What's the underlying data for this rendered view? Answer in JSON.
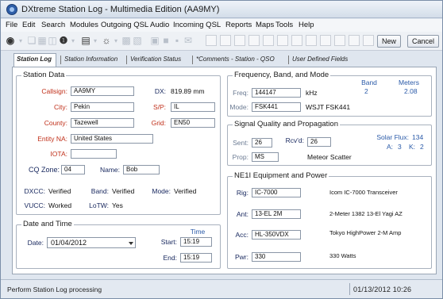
{
  "window": {
    "title": "DXtreme Station Log - Multimedia Edition (AA9MY)"
  },
  "menu": [
    "File",
    "Edit",
    "Search",
    "Modules",
    "Outgoing QSL",
    "Audio",
    "Incoming QSL",
    "Reports",
    "Maps",
    "Tools",
    "Help"
  ],
  "toolbar": {
    "new_label": "New",
    "cancel_label": "Cancel"
  },
  "tabs": [
    "Station Log",
    "Station Information",
    "Verification Status",
    "*Comments - Station - QSO",
    "User Defined Fields"
  ],
  "station_data": {
    "title": "Station Data",
    "callsign_label": "Callsign:",
    "callsign": "AA9MY",
    "dx_label": "DX:",
    "dx": "819.89 mm",
    "city_label": "City:",
    "city": "Pekin",
    "sp_label": "S/P:",
    "sp": "IL",
    "county_label": "County:",
    "county": "Tazewell",
    "grid_label": "Grid:",
    "grid": "EN50",
    "entity_label": "Entity NA:",
    "entity": "United States",
    "iota_label": "IOTA:",
    "iota": "",
    "cq_label": "CQ Zone:",
    "cq": "04",
    "name_label": "Name:",
    "name": "Bob",
    "dxcc_label": "DXCC:",
    "dxcc": "Verified",
    "band_label": "Band:",
    "band": "Verified",
    "mode_label": "Mode:",
    "mode": "Verified",
    "vucc_label": "VUCC:",
    "vucc": "Worked",
    "lotw_label": "LoTW:",
    "lotw": "Yes"
  },
  "datetime": {
    "title": "Date and Time",
    "time_header": "Time",
    "date_label": "Date:",
    "date": "01/04/2012",
    "start_label": "Start:",
    "start": "15:19",
    "end_label": "End:",
    "end": "15:19"
  },
  "freq": {
    "title": "Frequency, Band, and Mode",
    "band_header": "Band",
    "meters_header": "Meters",
    "band_value": "2",
    "meters_value": "2.08",
    "freq_label": "Freq:",
    "freq": "144147",
    "unit": "kHz",
    "mode_label": "Mode:",
    "mode": "FSK441",
    "mode_desc": "WSJT FSK441"
  },
  "signal": {
    "title": "Signal Quality and Propagation",
    "sent_label": "Sent:",
    "sent": "26",
    "rcvd_label": "Rcv'd:",
    "rcvd": "26",
    "prop_label": "Prop:",
    "prop": "MS",
    "prop_desc": "Meteor Scatter",
    "solar_flux_label": "Solar Flux:",
    "solar_flux": "134",
    "a_label": "A:",
    "a": "3",
    "k_label": "K:",
    "k": "2"
  },
  "equipment": {
    "title": "NE1I Equipment and Power",
    "rig_label": "Rig:",
    "rig": "IC-7000",
    "rig_desc": "Icom IC-7000 Transceiver",
    "ant_label": "Ant:",
    "ant": "13-EL 2M",
    "ant_desc": "2-Meter 1382 13-El Yagi AZ",
    "acc_label": "Acc:",
    "acc": "HL-350VDX",
    "acc_desc": "Tokyo HighPower 2-M Amp",
    "pwr_label": "Pwr:",
    "pwr": "330",
    "pwr_desc": "330 Watts"
  },
  "status": {
    "text": "Perform Station Log processing",
    "datetime": "01/13/2012  10:26"
  },
  "colors": {
    "label_red": "#c0301a",
    "accent_blue": "#2a5aa8"
  }
}
